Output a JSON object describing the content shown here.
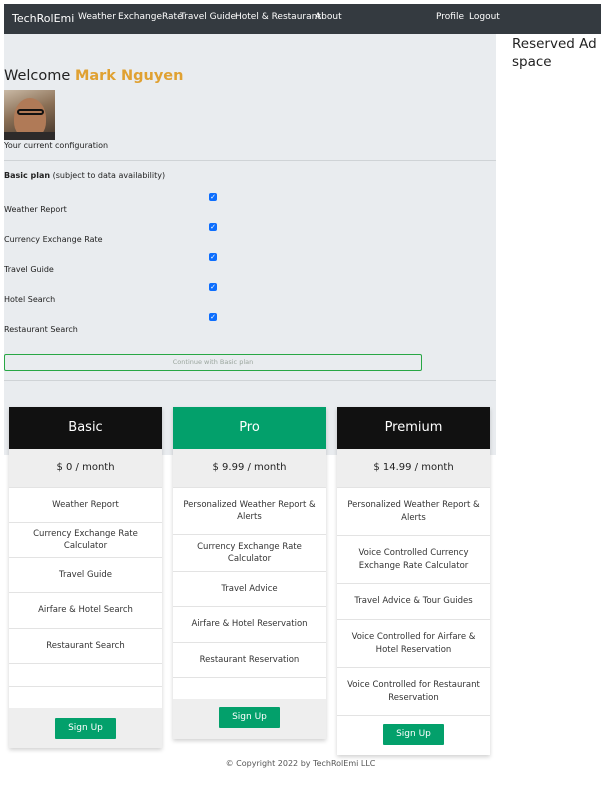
{
  "navbar": {
    "brand": "TechRolEmi",
    "links": [
      "Weather",
      "ExchangeRate",
      "Travel Guide",
      "Hotel & Restaurant",
      "About"
    ],
    "right_links": [
      "Profile",
      "Logout"
    ]
  },
  "ad": {
    "text": "Reserved Ad space"
  },
  "welcome": {
    "prefix": "Welcome",
    "name": "Mark Nguyen"
  },
  "config": {
    "caption": "Your current configuration",
    "plan_title": "Basic plan",
    "plan_note": "(subject to data availability)",
    "features": [
      "Weather Report",
      "Currency Exchange Rate",
      "Travel Guide",
      "Hotel Search",
      "Restaurant Search"
    ],
    "continue_label": "Continue with Basic plan"
  },
  "plans": [
    {
      "name": "Basic",
      "price": "$ 0 / month",
      "features": [
        "Weather Report",
        "Currency Exchange Rate Calculator",
        "Travel Guide",
        "Airfare & Hotel Search",
        "Restaurant Search"
      ],
      "signup_label": "Sign Up",
      "header_color": "#111111"
    },
    {
      "name": "Pro",
      "price": "$ 9.99 / month",
      "features": [
        "Personalized Weather Report & Alerts",
        "Currency Exchange Rate Calculator",
        "Travel Advice",
        "Airfare & Hotel Reservation",
        "Restaurant Reservation"
      ],
      "signup_label": "Sign Up",
      "header_color": "#03a06b"
    },
    {
      "name": "Premium",
      "price": "$ 14.99 / month",
      "features": [
        "Personalized Weather Report & Alerts",
        "Voice Controlled Currency Exchange Rate Calculator",
        "Travel Advice & Tour Guides",
        "Voice Controlled for Airfare & Hotel Reservation",
        "Voice Controlled for Restaurant Reservation"
      ],
      "signup_label": "Sign Up",
      "header_color": "#111111"
    }
  ],
  "footer": {
    "copyright": "© Copyright 2022 by TechRolEmi LLC"
  },
  "colors": {
    "navbar": "#343a40",
    "accent_name": "#e0a132",
    "checkbox": "#0d6efd",
    "signup": "#03a06b",
    "panel": "#e9ecef"
  }
}
